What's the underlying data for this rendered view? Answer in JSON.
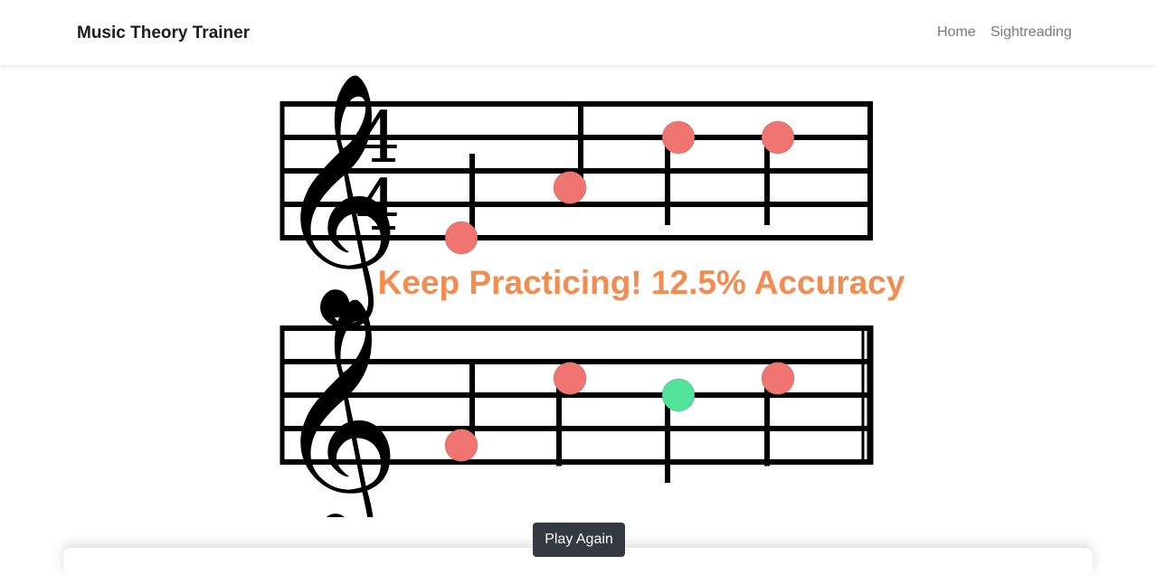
{
  "navbar": {
    "brand": "Music Theory Trainer",
    "links": [
      {
        "label": "Home"
      },
      {
        "label": "Sightreading"
      }
    ]
  },
  "result": {
    "message": "Keep Practicing! 12.5% Accuracy"
  },
  "score": {
    "clef": "treble",
    "time_signature": {
      "top": "4",
      "bottom": "4"
    },
    "note_colors": {
      "incorrect": "#f07470",
      "correct": "#52e39a"
    },
    "staves": [
      {
        "notes": [
          {
            "pitch": "E4",
            "correct": false,
            "stem": "up"
          },
          {
            "pitch": "A4",
            "correct": false,
            "stem": "up"
          },
          {
            "pitch": "D5",
            "correct": false,
            "stem": "down"
          },
          {
            "pitch": "D5",
            "correct": false,
            "stem": "down"
          }
        ]
      },
      {
        "notes": [
          {
            "pitch": "F4",
            "correct": false,
            "stem": "up"
          },
          {
            "pitch": "C5",
            "correct": false,
            "stem": "down"
          },
          {
            "pitch": "B4",
            "correct": true,
            "stem": "down"
          },
          {
            "pitch": "C5",
            "correct": false,
            "stem": "down"
          }
        ]
      }
    ]
  },
  "actions": {
    "play_again_label": "Play Again"
  }
}
